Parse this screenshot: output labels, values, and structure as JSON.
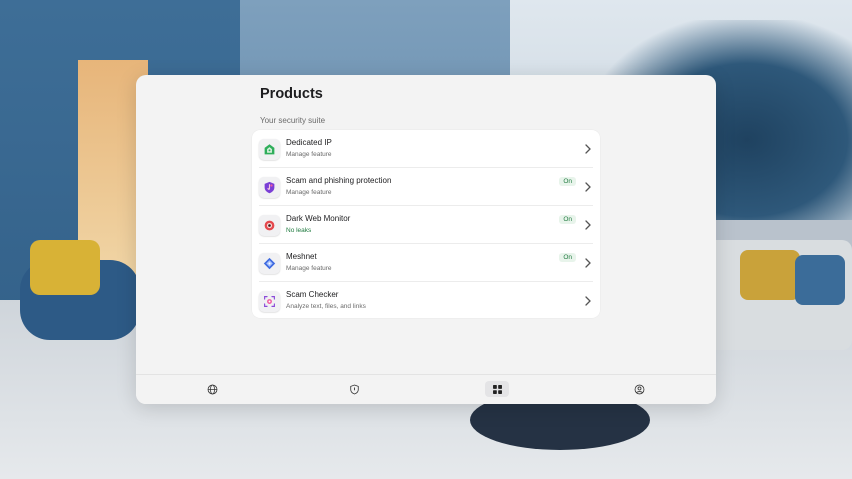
{
  "page": {
    "title": "Products",
    "section_label": "Your security suite"
  },
  "products": [
    {
      "name": "Dedicated IP",
      "subtitle": "Manage feature",
      "status": "",
      "icon": "house-shield-icon",
      "subtitle_color": "gray"
    },
    {
      "name": "Scam and phishing protection",
      "subtitle": "Manage feature",
      "status": "On",
      "icon": "shield-hook-icon",
      "subtitle_color": "gray"
    },
    {
      "name": "Dark Web Monitor",
      "subtitle": "No leaks",
      "status": "On",
      "icon": "eye-icon",
      "subtitle_color": "green"
    },
    {
      "name": "Meshnet",
      "subtitle": "Manage feature",
      "status": "On",
      "icon": "mesh-diamond-icon",
      "subtitle_color": "gray"
    },
    {
      "name": "Scam Checker",
      "subtitle": "Analyze text, files, and links",
      "status": "",
      "icon": "scan-face-icon",
      "subtitle_color": "gray"
    }
  ],
  "bottom_nav": [
    {
      "name": "globe-icon",
      "active": false
    },
    {
      "name": "shield-icon",
      "active": false
    },
    {
      "name": "grid-icon",
      "active": true
    },
    {
      "name": "profile-icon",
      "active": false
    }
  ],
  "colors": {
    "accent_green": "#1f7a3f",
    "badge_bg": "#e8f4eb"
  }
}
